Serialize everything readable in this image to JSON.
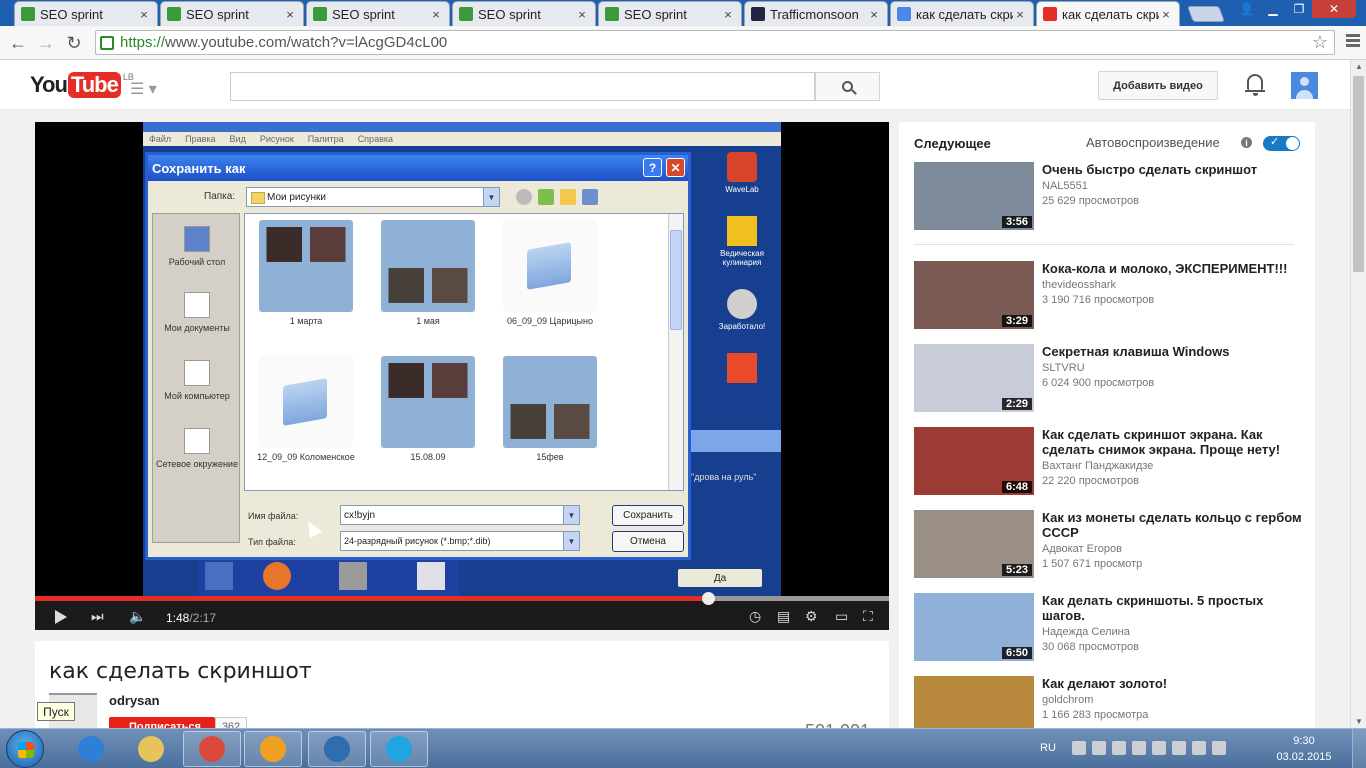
{
  "browser": {
    "tabs": [
      {
        "title": "SEO sprint",
        "active": false,
        "favicon_color": "#3a9b3a"
      },
      {
        "title": "SEO sprint",
        "active": false,
        "favicon_color": "#3a9b3a"
      },
      {
        "title": "SEO sprint",
        "active": false,
        "favicon_color": "#3a9b3a"
      },
      {
        "title": "SEO sprint",
        "active": false,
        "favicon_color": "#3a9b3a"
      },
      {
        "title": "SEO sprint",
        "active": false,
        "favicon_color": "#3a9b3a"
      },
      {
        "title": "Trafficmonsoon",
        "active": false,
        "favicon_color": "#222244"
      },
      {
        "title": "как сделать скри",
        "active": false,
        "favicon_color": "#4a87e8"
      },
      {
        "title": "как сделать скри",
        "active": true,
        "favicon_color": "#e52d27"
      }
    ],
    "url_https": "https://",
    "url_rest": "www.youtube.com/watch?v=lAcgGD4cL00"
  },
  "youtube": {
    "logo_you": "You",
    "logo_tube": "Tube",
    "logo_country": "LB",
    "upload_label": "Добавить видео",
    "accent": "#e52d27"
  },
  "player": {
    "time_current": "1:48",
    "time_separator": " / ",
    "time_duration": "2:17",
    "progress_fraction": 0.7883,
    "buffered_fraction": 1.0
  },
  "video_frame": {
    "menu_items": [
      "Файл",
      "Правка",
      "Вид",
      "Рисунок",
      "Палитра",
      "Справка"
    ],
    "dialog_title": "Сохранить как",
    "look_in_label": "Папка:",
    "look_in_value": "Мои рисунки",
    "places": [
      "Рабочий стол",
      "Мои документы",
      "Мой компьютер",
      "Сетевое окружение"
    ],
    "files": [
      "1 марта",
      "1 мая",
      "06_09_09 Царицыно",
      "12_09_09 Коломенское",
      "15.08.09",
      "15фев"
    ],
    "file_name_label": "Имя файла:",
    "file_name_value": "cx!byjn",
    "file_type_label": "Тип файла:",
    "file_type_value": "24-разрядный рисунок (*.bmp;*.dib)",
    "save_button": "Сохранить",
    "cancel_button": "Отмена",
    "desktop_icons": [
      "WaveLab",
      "Ведическая кулинария",
      "Заработало!"
    ],
    "right_text": "\"дрова на руль\"",
    "da_button": "Да"
  },
  "video_info": {
    "title": "как сделать скриншот",
    "channel": "odrysan",
    "subscribe_label": "Подписаться",
    "subscriber_count": "362",
    "view_count": "501 001",
    "tooltip": "Пуск"
  },
  "sidebar": {
    "up_next_label": "Следующее",
    "autoplay_label": "Автовоспроизведение",
    "autoplay_on": true,
    "items": [
      {
        "title": "Очень быстро сделать скриншот",
        "channel": "NAL5551",
        "views": "25 629 просмотров",
        "duration": "3:56",
        "thumb": "#7c8a9a"
      },
      {
        "title": "Кока-кола и молоко, ЭКСПЕРИМЕНТ!!!",
        "channel": "thevideosshark",
        "views": "3 190 716 просмотров",
        "duration": "3:29",
        "thumb": "#7a5a52"
      },
      {
        "title": "Секретная клавиша Windows",
        "channel": "SLTVRU",
        "views": "6 024 900 просмотров",
        "duration": "2:29",
        "thumb": "#c7ccd8"
      },
      {
        "title": "Как сделать скриншот экрана. Как сделать снимок экрана. Проще нету!",
        "channel": "Вахтанг Панджакидзе",
        "views": "22 220 просмотров",
        "duration": "6:48",
        "thumb": "#9c3b33"
      },
      {
        "title": "Как из монеты сделать кольцо с гербом СССР",
        "channel": "Адвокат Егоров",
        "views": "1 507 671 просмотр",
        "duration": "5:23",
        "thumb": "#9a8f84"
      },
      {
        "title": "Как делать скриншоты. 5 простых шагов.",
        "channel": "Надежда Селина",
        "views": "30 068 просмотров",
        "duration": "6:50",
        "thumb": "#8fb1d8"
      },
      {
        "title": "Как делают золото!",
        "channel": "goldchrom",
        "views": "1 166 283 просмотра",
        "duration": "",
        "thumb": "#b8893c"
      }
    ]
  },
  "taskbar": {
    "language": "RU",
    "time": "9:30",
    "date": "03.02.2015",
    "apps": [
      {
        "name": "internet-explorer",
        "color": "#2f7fd6"
      },
      {
        "name": "file-explorer",
        "color": "#e8c25a"
      },
      {
        "name": "chrome",
        "color": "#d94a3c"
      },
      {
        "name": "media-player",
        "color": "#f0a020"
      },
      {
        "name": "wireless",
        "color": "#2d6db0"
      },
      {
        "name": "skype",
        "color": "#1fa6e0"
      }
    ]
  }
}
